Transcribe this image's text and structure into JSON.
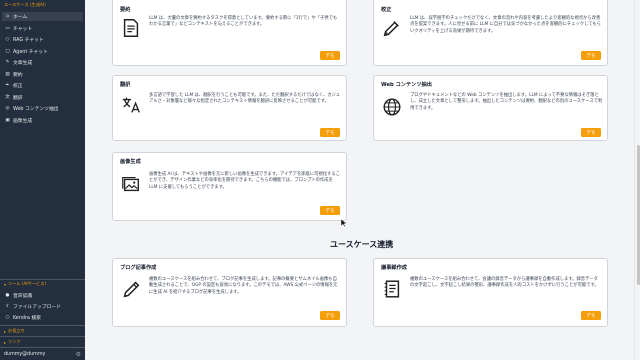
{
  "sidebar": {
    "header": "ユースケース (生成AI)",
    "items": [
      {
        "label": "ホーム",
        "icon": "home-icon",
        "active": true
      },
      {
        "label": "チャット",
        "icon": "chat-icon"
      },
      {
        "label": "RAG チャット",
        "icon": "search-icon"
      },
      {
        "label": "Agent チャット",
        "icon": "robot-icon"
      },
      {
        "label": "文章生成",
        "icon": "pen-icon"
      },
      {
        "label": "要約",
        "icon": "document-icon"
      },
      {
        "label": "校正",
        "icon": "pen-nib-icon"
      },
      {
        "label": "翻訳",
        "icon": "translate-icon"
      },
      {
        "label": "Web コンテンツ抽出",
        "icon": "globe-icon"
      },
      {
        "label": "画像生成",
        "icon": "image-icon"
      }
    ],
    "tools_section": "ツール (AIサービス)",
    "tools": [
      {
        "label": "音声認識",
        "icon": "microphone-icon"
      },
      {
        "label": "ファイルアップロード",
        "icon": "upload-icon"
      },
      {
        "label": "Kendra 検索",
        "icon": "search-icon"
      }
    ],
    "links_section": "お役立ち",
    "links_section_2": "リンク",
    "user": "dummy@dummy"
  },
  "cards": {
    "summary": {
      "title": "要約",
      "desc": "LLM は、大量の文章を要約するタスクを得意としています。要約する際に「1行で」や「子供でもわかる言葉で」などコンテキストを与えることができます。"
    },
    "proofread": {
      "title": "校正",
      "desc": "LLM は、誤字脱字のチェックだけでなく、文章の流れや内容を考慮したより客観的な視点から改善点を提案できます。人に見せる前に LLM に自分では気づかなかった点を客観的にチェックしてもらいクオリティを上げる効果が期待できます。"
    },
    "translate": {
      "title": "翻訳",
      "desc": "多言語で学習した LLM は、翻訳を行うことも可能です。また、ただ翻訳するだけではなく、カジュアルさ・対象層など様々な指定されたコンテキスト情報を翻訳に反映させることが可能です。"
    },
    "web": {
      "title": "Web コンテンツ抽出",
      "desc": "ブログやドキュメントなどの Web コンテンツを抽出します。LLM によって不要な情報はそぎ落とし、成立した文章として整形します。抽出したコンテンツは要約、翻訳などの別のユースケースで利用できます。"
    },
    "image": {
      "title": "画像生成",
      "desc": "画像生成 AI は、テキストや画像を元に新しい画像を生成できます。アイデアを即座に可視化することができ、デザイン作業などの効率化を期待できます。こちらの機能では、プロンプトの作成を LLM に支援してもらうことができます。"
    },
    "blog": {
      "title": "ブログ記事作成",
      "desc": "複数のユースケースを組み合わせて、ブログ記事を生成します。記事の概要とサムネイル画像も自動生成されることで、OGP の設定も容易になります。このデモでは、AWS 公式ページの情報を元に生成 AI を紹介するブログ記事を生成します。"
    },
    "minutes": {
      "title": "議事録作成",
      "desc": "複数のユースケースを組み合わせて、会議の録音データから議事録を自動作成します。録音データの文字起こし、文字起こし結果の整形、議事録作成を人的コストをかけずに行うことが可能です。"
    }
  },
  "demo_label": "デモ",
  "section_title": "ユースケース連携",
  "colors": {
    "accent": "#f59e0b",
    "sidebar": "#232f3e"
  }
}
